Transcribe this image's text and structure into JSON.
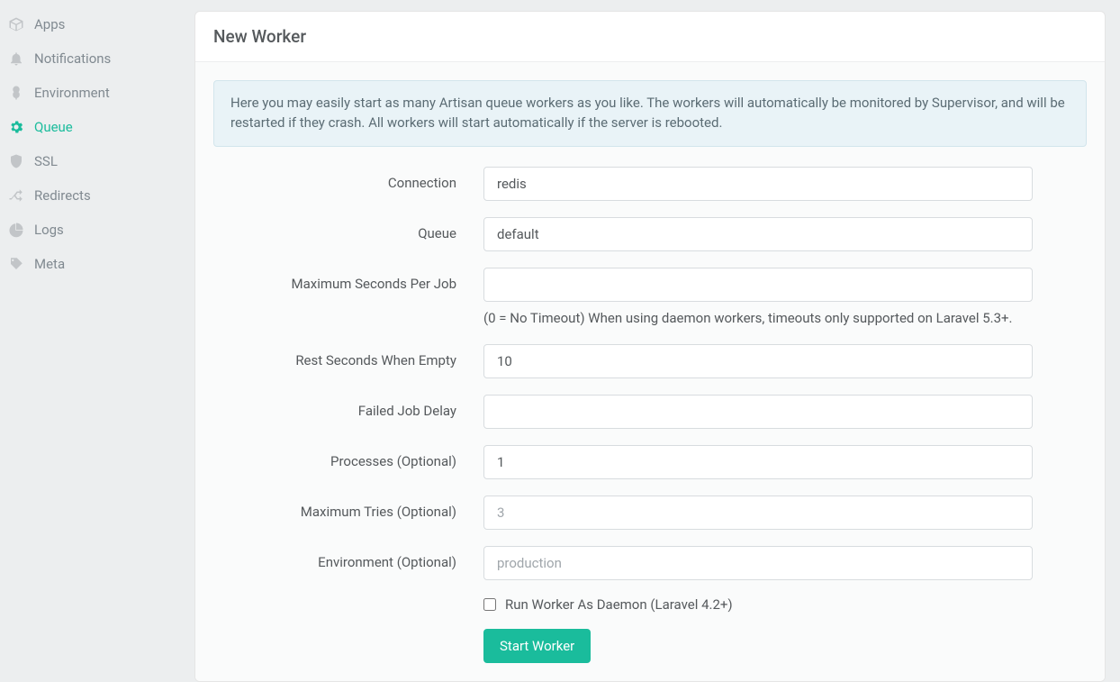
{
  "sidebar": {
    "items": [
      {
        "label": "Apps",
        "icon": "cube-icon"
      },
      {
        "label": "Notifications",
        "icon": "bell-icon"
      },
      {
        "label": "Environment",
        "icon": "tree-icon"
      },
      {
        "label": "Queue",
        "icon": "gear-icon",
        "active": true
      },
      {
        "label": "SSL",
        "icon": "shield-icon"
      },
      {
        "label": "Redirects",
        "icon": "shuffle-icon"
      },
      {
        "label": "Logs",
        "icon": "pie-icon"
      },
      {
        "label": "Meta",
        "icon": "tag-icon"
      }
    ]
  },
  "card": {
    "title": "New Worker",
    "info": "Here you may easily start as many Artisan queue workers as you like. The workers will automatically be monitored by Supervisor, and will be restarted if they crash. All workers will start automatically if the server is rebooted."
  },
  "form": {
    "connection": {
      "label": "Connection",
      "value": "redis"
    },
    "queue": {
      "label": "Queue",
      "value": "default"
    },
    "max_seconds": {
      "label": "Maximum Seconds Per Job",
      "value": "",
      "help": "(0 = No Timeout) When using daemon workers, timeouts only supported on Laravel 5.3+."
    },
    "rest_seconds": {
      "label": "Rest Seconds When Empty",
      "value": "10"
    },
    "failed_delay": {
      "label": "Failed Job Delay",
      "value": ""
    },
    "processes": {
      "label": "Processes (Optional)",
      "value": "1"
    },
    "max_tries": {
      "label": "Maximum Tries (Optional)",
      "placeholder": "3",
      "value": ""
    },
    "environment": {
      "label": "Environment (Optional)",
      "placeholder": "production",
      "value": ""
    },
    "daemon": {
      "label": "Run Worker As Daemon (Laravel 4.2+)"
    },
    "submit": "Start Worker"
  }
}
